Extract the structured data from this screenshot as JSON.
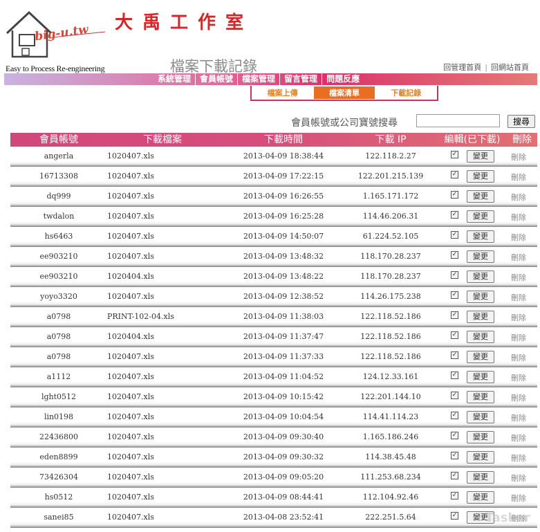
{
  "brand": {
    "studio_name": "大禹工作室",
    "logo_script": "big-u.tw",
    "tagline": "Easy to Process Re-engineering"
  },
  "page_title": "檔案下載記錄",
  "top_links": [
    "回管理首頁",
    "回網站首頁"
  ],
  "nav": [
    "系統管理",
    "會員帳號",
    "檔案管理",
    "留言管理",
    "問題反應"
  ],
  "subnav": [
    {
      "label": "檔案上傳",
      "active": false
    },
    {
      "label": "檔案清單",
      "active": true
    },
    {
      "label": "下載記錄",
      "active": false
    }
  ],
  "search": {
    "label": "會員帳號或公司寶號搜尋",
    "value": "",
    "button": "搜尋"
  },
  "table": {
    "headers": [
      "會員帳號",
      "下載檔案",
      "下載時間",
      "下載 IP",
      "編輯(已下載)",
      "刪除"
    ],
    "edit_label": "變更",
    "delete_label": "刪除",
    "rows": [
      {
        "account": "angerla",
        "file": "1020407.xls",
        "time": "2013-04-09 18:38:44",
        "ip": "122.118.2.27",
        "checked": true
      },
      {
        "account": "16713308",
        "file": "1020407.xls",
        "time": "2013-04-09 17:22:15",
        "ip": "122.201.215.139",
        "checked": true
      },
      {
        "account": "dq999",
        "file": "1020407.xls",
        "time": "2013-04-09 16:26:55",
        "ip": "1.165.171.172",
        "checked": true
      },
      {
        "account": "twdalon",
        "file": "1020407.xls",
        "time": "2013-04-09 16:25:28",
        "ip": "114.46.206.31",
        "checked": true
      },
      {
        "account": "hs6463",
        "file": "1020407.xls",
        "time": "2013-04-09 14:50:07",
        "ip": "61.224.52.105",
        "checked": true
      },
      {
        "account": "ee903210",
        "file": "1020407.xls",
        "time": "2013-04-09 13:48:32",
        "ip": "118.170.28.237",
        "checked": true
      },
      {
        "account": "ee903210",
        "file": "1020404.xls",
        "time": "2013-04-09 13:48:22",
        "ip": "118.170.28.237",
        "checked": true
      },
      {
        "account": "yoyo3320",
        "file": "1020407.xls",
        "time": "2013-04-09 12:38:52",
        "ip": "114.26.175.238",
        "checked": true
      },
      {
        "account": "a0798",
        "file": "PRINT-102-04.xls",
        "time": "2013-04-09 11:38:03",
        "ip": "122.118.52.186",
        "checked": true
      },
      {
        "account": "a0798",
        "file": "1020404.xls",
        "time": "2013-04-09 11:37:47",
        "ip": "122.118.52.186",
        "checked": true
      },
      {
        "account": "a0798",
        "file": "1020407.xls",
        "time": "2013-04-09 11:37:33",
        "ip": "122.118.52.186",
        "checked": true
      },
      {
        "account": "a1112",
        "file": "1020407.xls",
        "time": "2013-04-09 11:04:52",
        "ip": "124.12.33.161",
        "checked": true
      },
      {
        "account": "lght0512",
        "file": "1020407.xls",
        "time": "2013-04-09 10:15:42",
        "ip": "122.201.144.10",
        "checked": true
      },
      {
        "account": "lin0198",
        "file": "1020407.xls",
        "time": "2013-04-09 10:04:54",
        "ip": "114.41.114.23",
        "checked": true
      },
      {
        "account": "22436800",
        "file": "1020407.xls",
        "time": "2013-04-09 09:30:40",
        "ip": "1.165.186.246",
        "checked": true
      },
      {
        "account": "eden8899",
        "file": "1020407.xls",
        "time": "2013-04-09 09:30:32",
        "ip": "114.38.45.48",
        "checked": true
      },
      {
        "account": "73426304",
        "file": "1020407.xls",
        "time": "2013-04-09 09:05:20",
        "ip": "111.253.68.234",
        "checked": true
      },
      {
        "account": "hs0512",
        "file": "1020407.xls",
        "time": "2013-04-09 08:44:41",
        "ip": "112.104.92.46",
        "checked": true
      },
      {
        "account": "sanei85",
        "file": "1020407.xls",
        "time": "2013-04-08 23:52:41",
        "ip": "222.251.5.64",
        "checked": true
      }
    ]
  },
  "watermark": "Tasker"
}
